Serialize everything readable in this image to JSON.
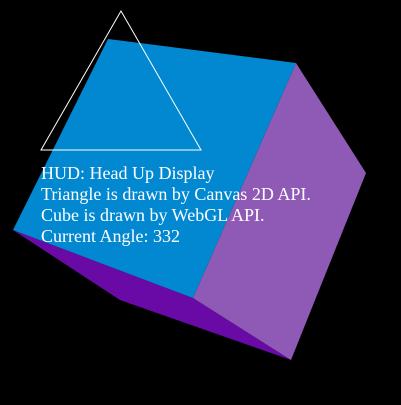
{
  "scene": {
    "background": "#000000",
    "cube": {
      "front_face_color": "#0288d1",
      "right_face_color": "#8e5ab5",
      "bottom_face_color": "#6a0aa6",
      "angle_degrees": 332
    },
    "triangle": {
      "stroke_color": "#ffffff"
    }
  },
  "hud": {
    "line1": "HUD: Head Up Display",
    "line2": "Triangle is drawn by Canvas 2D API.",
    "line3": "Cube is drawn by WebGL API.",
    "line4": "Current Angle: 332"
  }
}
